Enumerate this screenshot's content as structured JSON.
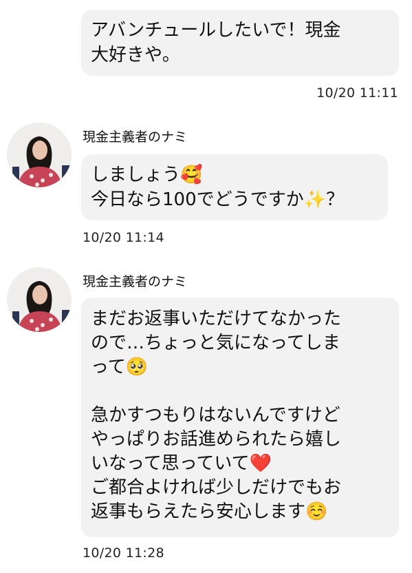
{
  "messages": [
    {
      "direction": "outgoing",
      "text": "アバンチュールしたいで！現金\n大好きや。",
      "time": "10/20 11:11"
    },
    {
      "direction": "incoming",
      "sender": "現金主義者のナミ",
      "text": "しましょう🥰\n今日なら100でどうですか✨？",
      "time": "10/20 11:14"
    },
    {
      "direction": "incoming",
      "sender": "現金主義者のナミ",
      "text": "まだお返事いただけてなかった\nので…ちょっと気になってしま\nって🥺\n\n急かすつもりはないんですけど\nやっぱりお話進められたら嬉し\nいなって思っていて❤️\nご都合よければ少しだけでもお\n返事もらえたら安心します☺️",
      "time": "10/20 11:28"
    }
  ],
  "colors": {
    "bubble": "#f2f2f2",
    "background": "#ffffff",
    "text": "#111111"
  }
}
